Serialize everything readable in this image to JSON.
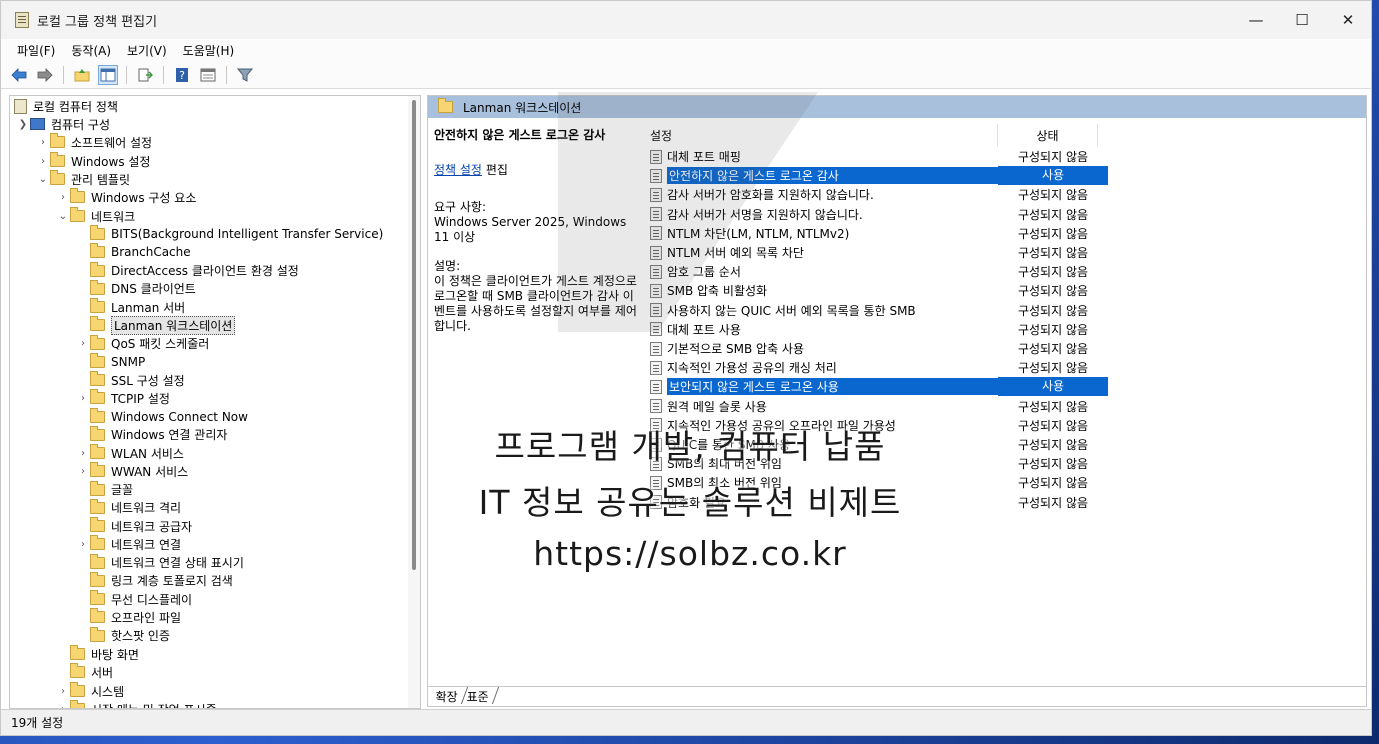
{
  "window": {
    "title": "로컬 그룹 정책 편집기",
    "minimize": "—",
    "maximize": "☐",
    "close": "✕"
  },
  "menu": [
    "파일(F)",
    "동작(A)",
    "보기(V)",
    "도움말(H)"
  ],
  "toolbar": {
    "icons": [
      "back-arrow-icon",
      "forward-arrow-icon",
      "up-folder-icon",
      "show-hide-tree-icon",
      "export-list-icon",
      "help-icon",
      "properties-icon",
      "filter-icon"
    ]
  },
  "tree": {
    "root": "로컬 컴퓨터 정책",
    "computer_config": "컴퓨터 구성",
    "software_settings": "소프트웨어 설정",
    "windows_settings": "Windows 설정",
    "admin_templates": "관리 템플릿",
    "windows_components": "Windows 구성 요소",
    "network": "네트워크",
    "network_children": [
      "BITS(Background Intelligent Transfer Service)",
      "BranchCache",
      "DirectAccess 클라이언트 환경 설정",
      "DNS 클라이언트",
      "Lanman 서버",
      "Lanman 워크스테이션",
      "QoS 패킷 스케줄러",
      "SNMP",
      "SSL 구성 설정",
      "TCPIP 설정",
      "Windows Connect Now",
      "Windows 연결 관리자",
      "WLAN 서비스",
      "WWAN 서비스",
      "글꼴",
      "네트워크 격리",
      "네트워크 공급자",
      "네트워크 연결",
      "네트워크 연결 상태 표시기",
      "링크 계층 토폴로지 검색",
      "무선 디스플레이",
      "오프라인 파일",
      "핫스팟 인증"
    ],
    "desktop": "바탕 화면",
    "server": "서버",
    "system": "시스템",
    "start_menu_partial": "시작 메뉴 및 작업 표시줄"
  },
  "right_pane": {
    "header": "Lanman 워크스테이션",
    "desc_title": "안전하지 않은 게스트 로그온 감사",
    "policy_link": "정책 설정",
    "edit_text": "편집",
    "requirements_label": "요구 사항:",
    "requirements": "Windows Server 2025, Windows 11 이상",
    "description_label": "설명:",
    "description": "이 정책은 클라이언트가 게스트 계정으로 로그온할 때 SMB 클라이언트가 감사 이벤트를 사용하도록 설정할지 여부를 제어합니다.",
    "col_setting": "설정",
    "col_state": "상태",
    "policies": [
      {
        "name": "대체 포트 매핑",
        "state": "구성되지 않음"
      },
      {
        "name": "안전하지 않은 게스트 로그온 감사",
        "state": "사용"
      },
      {
        "name": "감사 서버가 암호화를 지원하지 않습니다.",
        "state": "구성되지 않음"
      },
      {
        "name": "감사 서버가 서명을 지원하지 않습니다.",
        "state": "구성되지 않음"
      },
      {
        "name": "NTLM 차단(LM, NTLM, NTLMv2)",
        "state": "구성되지 않음"
      },
      {
        "name": "NTLM 서버 예외 목록 차단",
        "state": "구성되지 않음"
      },
      {
        "name": "암호 그룹 순서",
        "state": "구성되지 않음"
      },
      {
        "name": "SMB 압축 비활성화",
        "state": "구성되지 않음"
      },
      {
        "name": "사용하지 않는 QUIC 서버 예외 목록을 통한 SMB",
        "state": "구성되지 않음"
      },
      {
        "name": "대체 포트 사용",
        "state": "구성되지 않음"
      },
      {
        "name": "기본적으로 SMB 압축 사용",
        "state": "구성되지 않음"
      },
      {
        "name": "지속적인 가용성 공유의 캐싱 처리",
        "state": "구성되지 않음"
      },
      {
        "name": "보안되지 않은 게스트 로그온 사용",
        "state": "사용"
      },
      {
        "name": "원격 메일 슬롯 사용",
        "state": "구성되지 않음"
      },
      {
        "name": "지속적인 가용성 공유의 오프라인 파일 가용성",
        "state": "구성되지 않음"
      },
      {
        "name": "QUIC를 통한 SMB 사용",
        "state": "구성되지 않음"
      },
      {
        "name": "SMB의 최대 버전 위임",
        "state": "구성되지 않음"
      },
      {
        "name": "SMB의 최소 버전 위임",
        "state": "구성되지 않음"
      },
      {
        "name": "암호화 필요",
        "state": "구성되지 않음"
      }
    ],
    "tabs": [
      "확장",
      "표준"
    ]
  },
  "status": "19개 설정",
  "overlay": {
    "line1": "프로그램 개발, 컴퓨터 납품",
    "line2": "IT 정보 공유는 솔루션 비제트",
    "line3": "https://solbz.co.kr"
  },
  "colors": {
    "selection": "#0a67d0",
    "pane_header": "#a9c0dc",
    "folder": "#f7d672"
  }
}
